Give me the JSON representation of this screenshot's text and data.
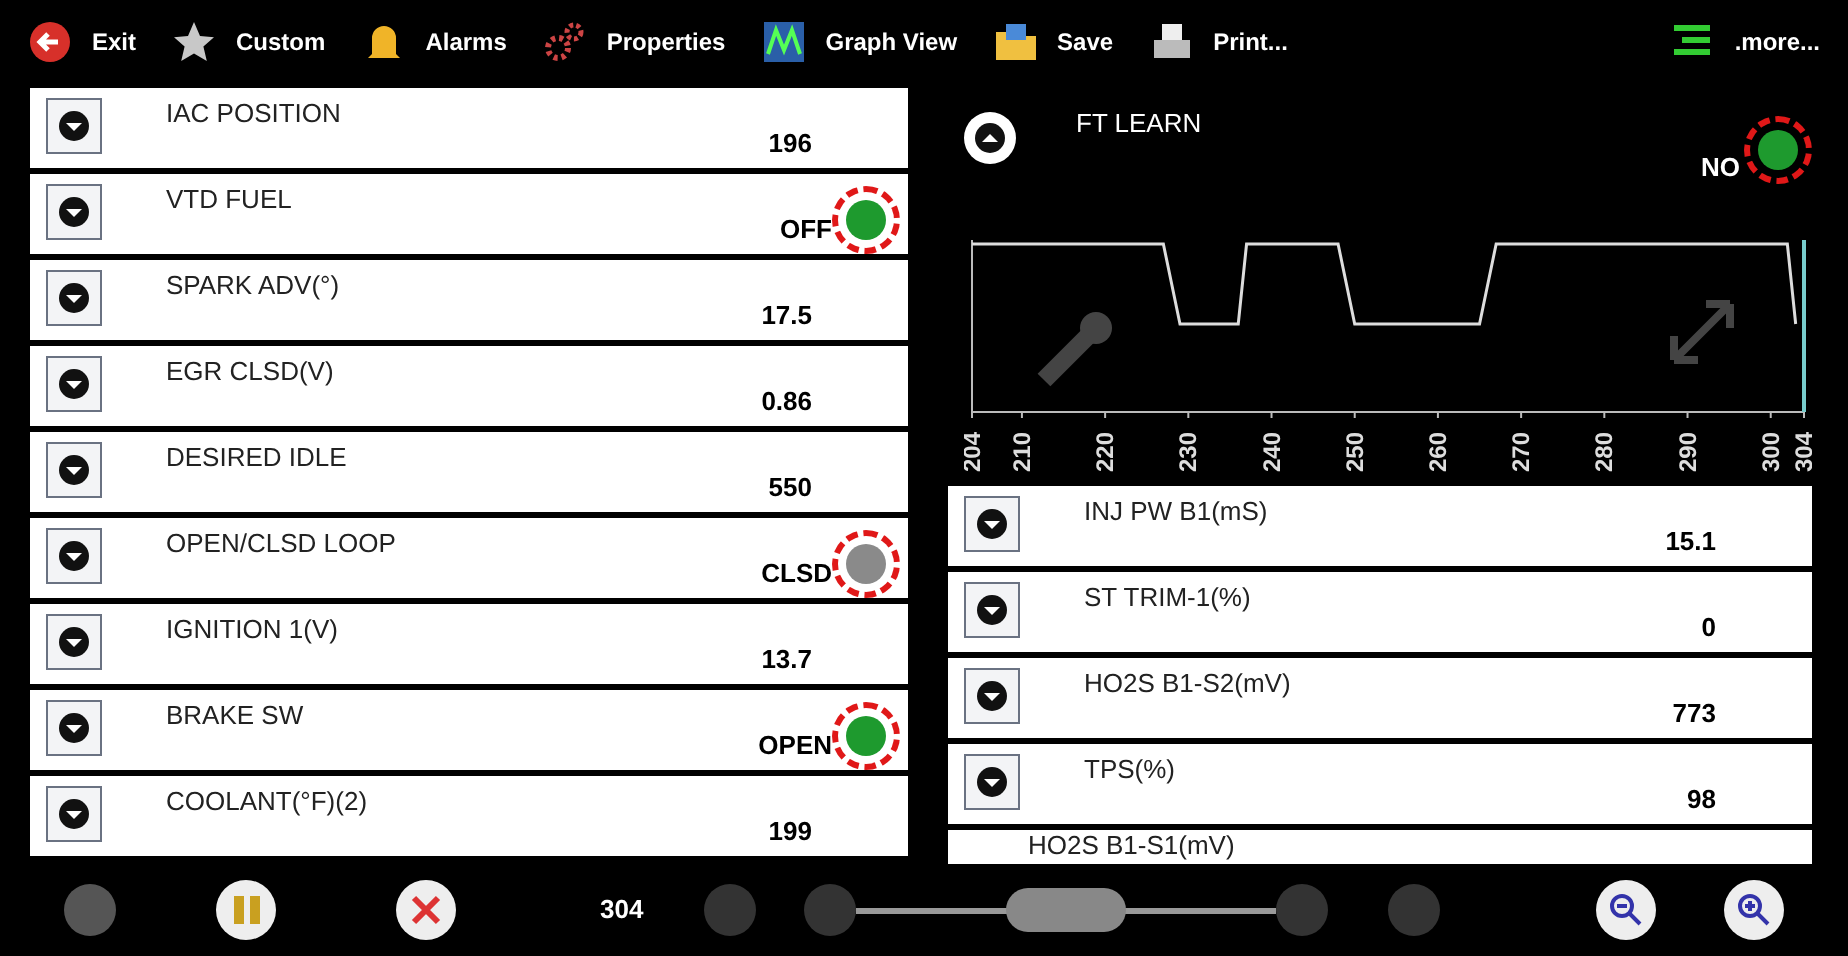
{
  "toolbar": [
    {
      "kind": "exit",
      "label": "Exit"
    },
    {
      "kind": "star",
      "label": "Custom"
    },
    {
      "kind": "bell",
      "label": "Alarms"
    },
    {
      "kind": "gears",
      "label": "Properties"
    },
    {
      "kind": "graph",
      "label": "Graph View"
    },
    {
      "kind": "save",
      "label": "Save"
    },
    {
      "kind": "print",
      "label": "Print..."
    },
    {
      "kind": "more",
      "label": ".more..."
    }
  ],
  "left_list": [
    {
      "name": "IAC POSITION",
      "value": "196"
    },
    {
      "name": "VTD FUEL",
      "value": "OFF",
      "color": "#1e9a2e",
      "annotated": true
    },
    {
      "name": "SPARK ADV(°)",
      "value": "17.5"
    },
    {
      "name": "EGR CLSD(V)",
      "value": "0.86"
    },
    {
      "name": "DESIRED IDLE",
      "value": "550"
    },
    {
      "name": "OPEN/CLSD LOOP",
      "value": "CLSD",
      "color": "#8a8a8a",
      "annotated": true
    },
    {
      "name": "IGNITION 1(V)",
      "value": "13.7"
    },
    {
      "name": "BRAKE SW",
      "value": "OPEN",
      "color": "#1e9a2e",
      "annotated": true
    },
    {
      "name": "COOLANT(°F)(2)",
      "value": "199"
    }
  ],
  "graph": {
    "name": "FT LEARN",
    "value": "NO",
    "color": "#1e9a2e",
    "annotated": true,
    "x_tick_labels": [
      "204",
      "210",
      "220",
      "230",
      "240",
      "250",
      "260",
      "270",
      "280",
      "290",
      "300",
      "304"
    ]
  },
  "right_list": [
    {
      "name": "INJ PW B1(mS)",
      "value": "15.1"
    },
    {
      "name": "ST TRIM-1(%)",
      "value": "0"
    },
    {
      "name": "HO2S B1-S2(mV)",
      "value": "773"
    },
    {
      "name": "TPS(%)",
      "value": "98"
    },
    {
      "name": "HO2S B1-S1(mV)"
    }
  ],
  "bottom_bar": {
    "frame": "304",
    "scrubber": {
      "level": 0.5
    }
  }
}
